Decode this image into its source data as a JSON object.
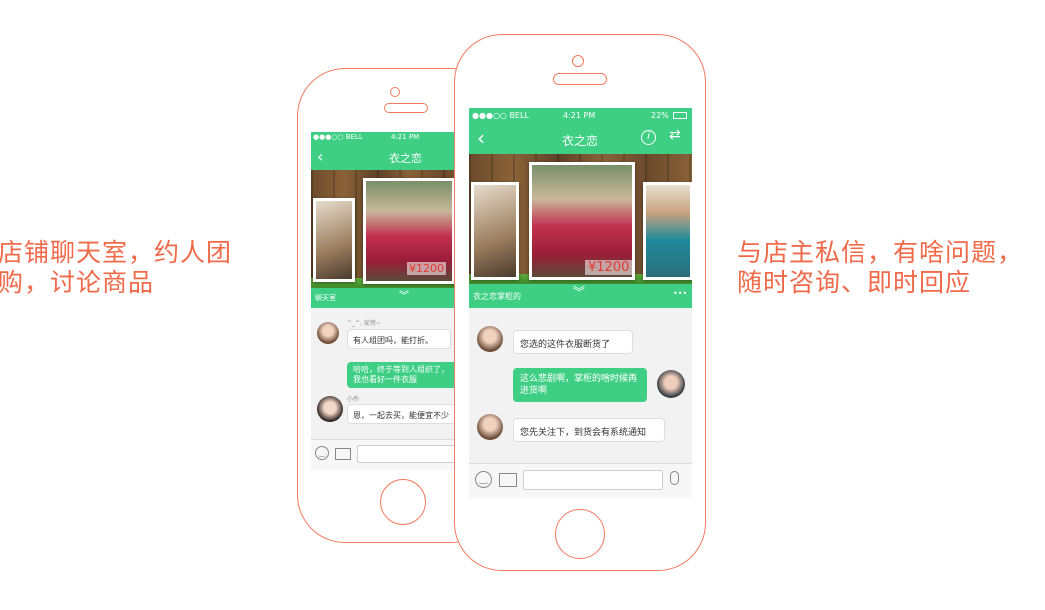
{
  "left_caption": {
    "line1": "店铺聊天室，约人团",
    "line2": "购，讨论商品"
  },
  "right_caption": {
    "line1": "与店主私信，有啥问题，",
    "line2": "随时咨询、即时回应"
  },
  "colors": {
    "accent": "#3fcf84",
    "frame": "#f07a5e",
    "caption": "#f06a4a",
    "price": "#e23a2e"
  },
  "phone_back": {
    "status": {
      "carrier": "●●●○○ BELL",
      "time": "4:21 PM"
    },
    "nav": {
      "back_icon": "chevron-left-icon",
      "title": "衣之恋"
    },
    "price": "¥1200",
    "section_label": "聊天室",
    "messages": [
      {
        "sender": "^_^, 安然~",
        "text": "有人组团吗，能打折。",
        "side": "left"
      },
      {
        "text": "哈哈，终于等到人组织了，我也看好一件衣服",
        "side": "right"
      },
      {
        "sender": "小乔",
        "text": "恩，一起去买，能便宜不少",
        "side": "left"
      }
    ],
    "input": {
      "emoji_icon": "smiley-icon",
      "image_icon": "image-icon",
      "placeholder": ""
    }
  },
  "phone_front": {
    "status": {
      "carrier": "●●●○○ BELL",
      "time": "4:21 PM",
      "battery": "22%"
    },
    "nav": {
      "back_icon": "chevron-left-icon",
      "title": "衣之恋",
      "info_icon": "info-icon",
      "swap_icon": "swap-icon"
    },
    "price": "¥1200",
    "section_label": "衣之恋掌柜的",
    "more_label": "•••",
    "messages": [
      {
        "text": "您选的这件衣服断货了",
        "side": "left"
      },
      {
        "text": "这么悲剧啊，掌柜的啥时候再进货啊",
        "side": "right"
      },
      {
        "text": "您先关注下，到货会有系统通知",
        "side": "left"
      }
    ],
    "input": {
      "emoji_icon": "smiley-icon",
      "image_icon": "image-icon",
      "mic_icon": "microphone-icon",
      "placeholder": ""
    }
  }
}
